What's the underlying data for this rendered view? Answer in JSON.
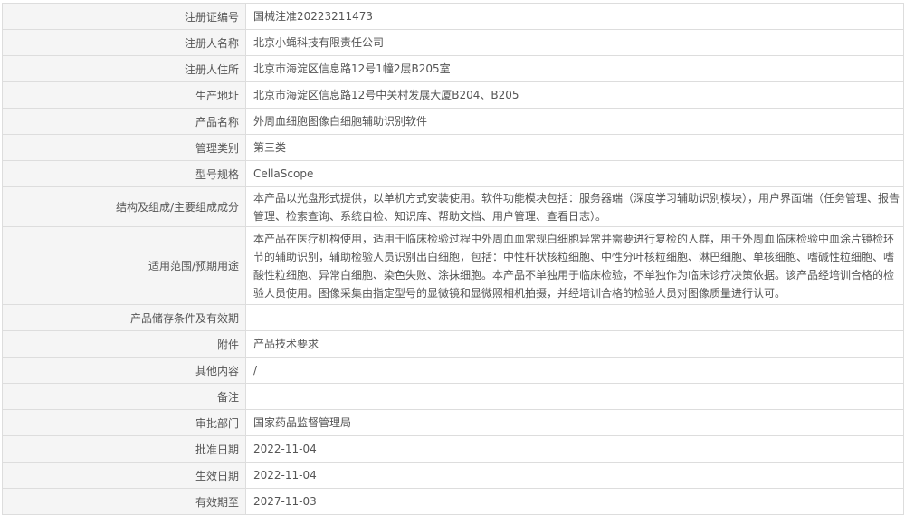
{
  "rows": [
    {
      "label": "注册证编号",
      "value": "国械注准20223211473"
    },
    {
      "label": "注册人名称",
      "value": "北京小蝇科技有限责任公司"
    },
    {
      "label": "注册人住所",
      "value": "北京市海淀区信息路12号1幢2层B205室"
    },
    {
      "label": "生产地址",
      "value": "北京市海淀区信息路12号中关村发展大厦B204、B205"
    },
    {
      "label": "产品名称",
      "value": "外周血细胞图像白细胞辅助识别软件"
    },
    {
      "label": "管理类别",
      "value": "第三类"
    },
    {
      "label": "型号规格",
      "value": "CellaScope"
    },
    {
      "label": "结构及组成/主要组成成分",
      "value": "本产品以光盘形式提供，以单机方式安装使用。软件功能模块包括：服务器端（深度学习辅助识别模块），用户界面端（任务管理、报告管理、检索查询、系统自检、知识库、帮助文档、用户管理、查看日志）。"
    },
    {
      "label": "适用范围/预期用途",
      "value": "本产品在医疗机构使用，适用于临床检验过程中外周血血常规白细胞异常并需要进行复检的人群，用于外周血临床检验中血涂片镜检环节的辅助识别，辅助检验人员识别出白细胞，包括：中性杆状核粒细胞、中性分叶核粒细胞、淋巴细胞、单核细胞、嗜碱性粒细胞、嗜酸性粒细胞、异常白细胞、染色失败、涂抹细胞。本产品不单独用于临床检验，不单独作为临床诊疗决策依据。该产品经培训合格的检验人员使用。图像采集由指定型号的显微镜和显微照相机拍摄，并经培训合格的检验人员对图像质量进行认可。"
    },
    {
      "label": "产品储存条件及有效期",
      "value": ""
    },
    {
      "label": "附件",
      "value": "产品技术要求"
    },
    {
      "label": "其他内容",
      "value": "/"
    },
    {
      "label": "备注",
      "value": ""
    },
    {
      "label": "审批部门",
      "value": "国家药品监督管理局"
    },
    {
      "label": "批准日期",
      "value": "2022-11-04"
    },
    {
      "label": "生效日期",
      "value": "2022-11-04"
    },
    {
      "label": "有效期至",
      "value": "2027-11-03"
    }
  ]
}
